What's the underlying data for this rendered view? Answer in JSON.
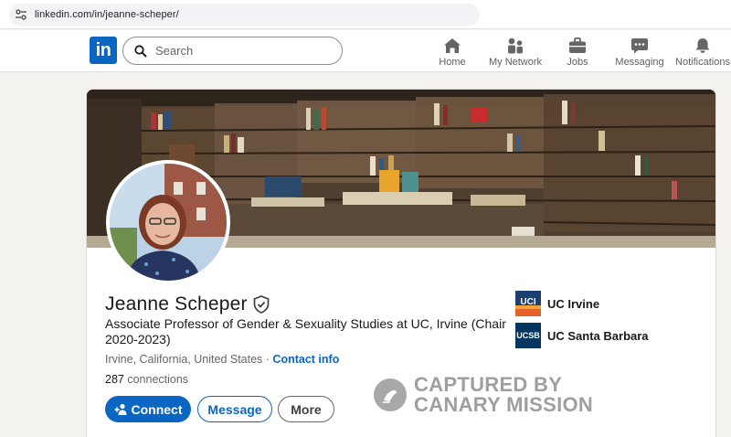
{
  "browser": {
    "url": "linkedin.com/in/jeanne-scheper/"
  },
  "nav": {
    "logo": "in",
    "search_placeholder": "Search",
    "items": [
      {
        "label": "Home",
        "icon": "home-icon"
      },
      {
        "label": "My Network",
        "icon": "network-icon"
      },
      {
        "label": "Jobs",
        "icon": "briefcase-icon"
      },
      {
        "label": "Messaging",
        "icon": "messaging-icon"
      },
      {
        "label": "Notifications",
        "icon": "bell-icon"
      }
    ]
  },
  "profile": {
    "name": "Jeanne Scheper",
    "headline": "Associate Professor of Gender & Sexuality Studies at UC, Irvine (Chair 2020-2023)",
    "location": "Irvine, California, United States",
    "separator": " · ",
    "contact_info": "Contact info",
    "connections_count": "287",
    "connections_label": " connections",
    "buttons": {
      "connect": "Connect",
      "message": "Message",
      "more": "More"
    },
    "schools": [
      {
        "logo_text": "UCI",
        "name": "UC Irvine",
        "color": "#1d3e71"
      },
      {
        "logo_text": "UCSB",
        "name": "UC Santa Barbara",
        "color": "#003660"
      }
    ]
  },
  "watermark": {
    "line1": "CAPTURED BY",
    "line2": "CANARY MISSION"
  },
  "colors": {
    "brand": "#0a66c2",
    "background": "#f4f2ee"
  }
}
